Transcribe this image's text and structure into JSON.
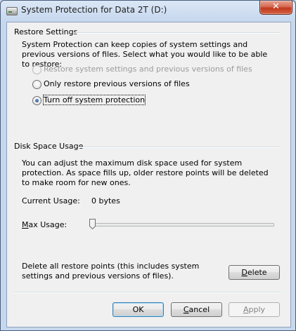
{
  "window": {
    "title": "System Protection for Data 2T (D:)",
    "close_glyph": "✕"
  },
  "restore_settings": {
    "title": "Restore Settings",
    "description": "System Protection can keep copies of system settings and previous versions of files. Select what you would like to be able to restore:",
    "options": [
      {
        "label": "Restore system settings and previous versions of files",
        "selected": false,
        "enabled": false
      },
      {
        "label": "Only restore previous versions of files",
        "selected": false,
        "enabled": true
      },
      {
        "label": "Turn off system protection",
        "selected": true,
        "enabled": true
      }
    ]
  },
  "disk_space": {
    "title": "Disk Space Usage",
    "description": "You can adjust the maximum disk space used for system protection. As space fills up, older restore points will be deleted to make room for new ones.",
    "current_usage_label": "Current Usage:",
    "current_usage_value": "0 bytes",
    "max_usage_label_accel": "M",
    "max_usage_label_rest": "ax Usage:",
    "max_usage_fraction": 0,
    "delete_description": "Delete all restore points (this includes system settings and previous versions of files).",
    "delete_button": {
      "accel": "D",
      "rest": "elete"
    }
  },
  "buttons": {
    "ok": "OK",
    "cancel": {
      "accel": "C",
      "rest": "ancel"
    },
    "apply": {
      "accel": "A",
      "rest": "pply"
    }
  },
  "colors": {
    "accent_close": "#c0391f",
    "radio_dot": "#163e78"
  }
}
